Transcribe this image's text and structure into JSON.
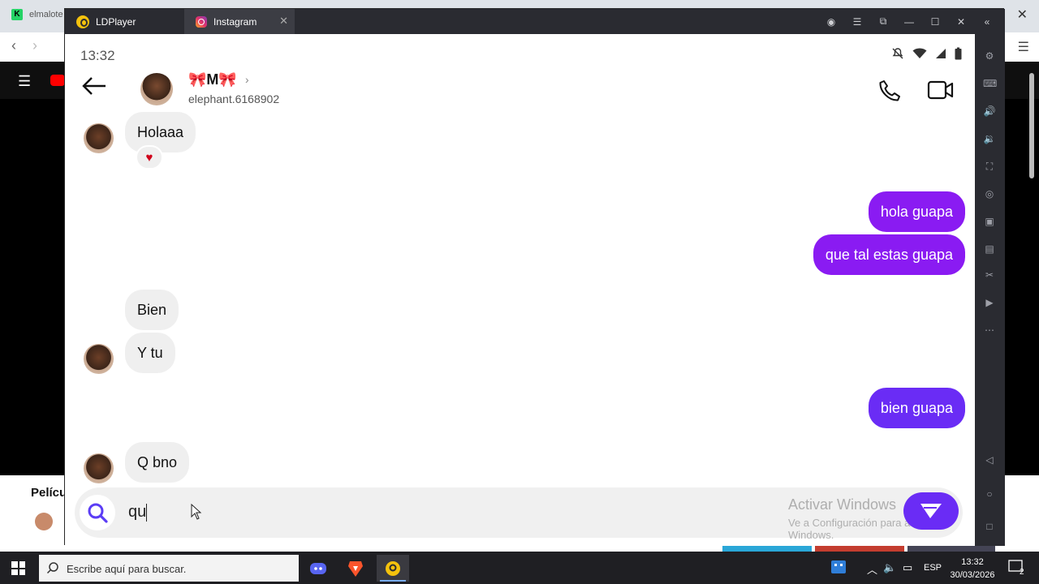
{
  "background_browser": {
    "tab_label": "elmalote",
    "favicon_letter": "K",
    "section_label": "Pelícu"
  },
  "ldplayer": {
    "tabs": [
      {
        "label": "LDPlayer",
        "icon": "ldplayer-logo-icon"
      },
      {
        "label": "Instagram",
        "icon": "instagram-icon"
      }
    ]
  },
  "status_bar": {
    "time": "13:32"
  },
  "chat_header": {
    "name": "🎀M🎀",
    "username": "elephant.6168902"
  },
  "messages": [
    {
      "direction": "in",
      "text": "Holaaa",
      "reaction": "♥"
    },
    {
      "direction": "out",
      "text": "hola guapa"
    },
    {
      "direction": "out",
      "text": "que tal estas guapa"
    },
    {
      "direction": "in",
      "text": "Bien"
    },
    {
      "direction": "in",
      "text": "Y tu"
    },
    {
      "direction": "out",
      "text": "bien  guapa"
    },
    {
      "direction": "in",
      "text": "Q bno"
    }
  ],
  "composer": {
    "value": "qu"
  },
  "watermark": {
    "line1": "Activar Windows",
    "line2": "Ve a Configuración para activar Windows."
  },
  "taskbar": {
    "search_placeholder": "Escribe aquí para buscar.",
    "language": "ESP",
    "time": "13:32",
    "date": "30/03/2026",
    "notification_count": "2"
  },
  "colors": {
    "outgoing_bubble": "#8a1bf2",
    "outgoing_bubble_alt": "#6a2cf5",
    "incoming_bubble": "#efefef"
  }
}
